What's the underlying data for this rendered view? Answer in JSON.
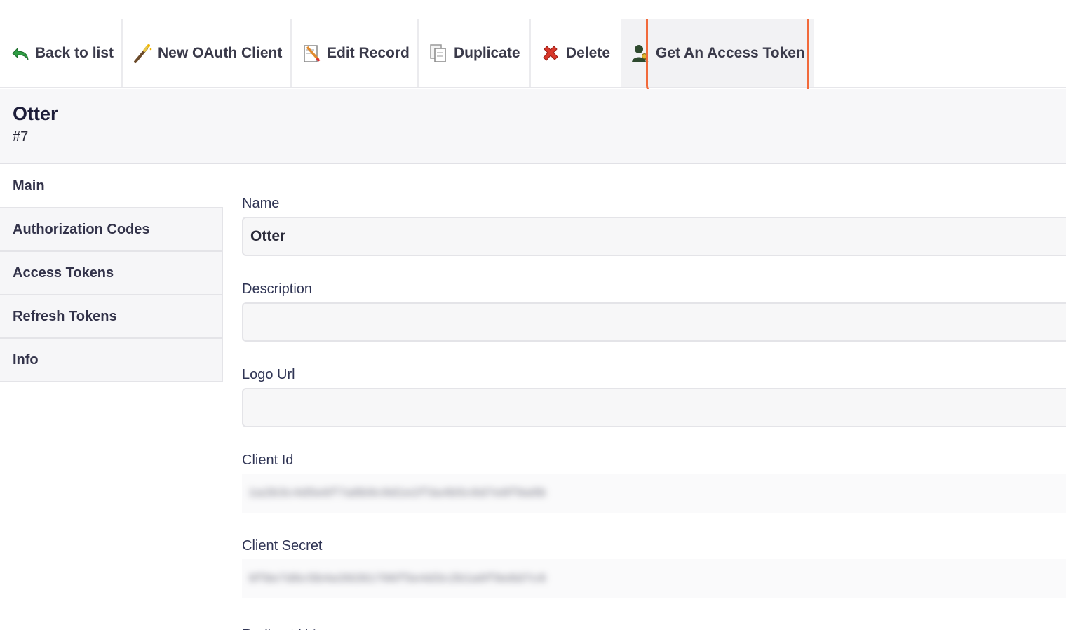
{
  "toolbar": {
    "buttons": [
      {
        "label": "Back to list",
        "icon": "undo-arrow-icon"
      },
      {
        "label": "New OAuth Client",
        "icon": "magic-wand-icon"
      },
      {
        "label": "Edit Record",
        "icon": "pencil-document-icon"
      },
      {
        "label": "Duplicate",
        "icon": "duplicate-document-icon"
      },
      {
        "label": "Delete",
        "icon": "red-x-icon"
      },
      {
        "label": "Get An Access Token",
        "icon": "user-key-icon",
        "active": true
      }
    ],
    "highlight_color": "#f26a3b"
  },
  "record": {
    "title": "Otter",
    "id": "#7"
  },
  "tabs": [
    {
      "label": "Main",
      "active": true
    },
    {
      "label": "Authorization Codes"
    },
    {
      "label": "Access Tokens"
    },
    {
      "label": "Refresh Tokens"
    },
    {
      "label": "Info"
    }
  ],
  "form": {
    "name": {
      "label": "Name",
      "value": "Otter"
    },
    "description": {
      "label": "Description",
      "value": ""
    },
    "logo_url": {
      "label": "Logo Url",
      "value": ""
    },
    "client_id": {
      "label": "Client Id",
      "value": "1a2b3c4d5e6f7a8b9c0d1e2f3a4b5c6d7e8f9a0b"
    },
    "client_secret": {
      "label": "Client Secret",
      "value": "9f8e7d6c5b4a39281706f5e4d3c2b1a0f9e8d7c6"
    },
    "next_label_partial": "Redirect Uri"
  }
}
